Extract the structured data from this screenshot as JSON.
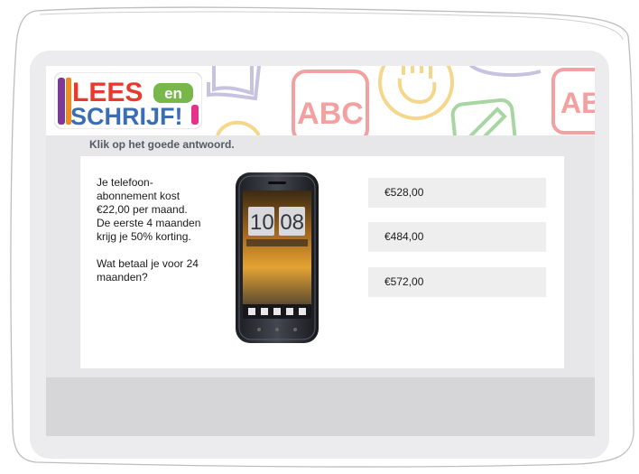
{
  "logo": {
    "line1": "LEES",
    "line1_small": "en",
    "line2": "SCHRIJF!",
    "colors": {
      "red": "#e63a2e",
      "purple": "#7b3a95",
      "orange": "#f28c1e",
      "green": "#78b84a",
      "blue": "#3a6db5",
      "pink": "#e8318a"
    }
  },
  "banner": {
    "deco_text_abc": "ABC",
    "deco_text_ab": "AB",
    "colors": {
      "red": "#f3a0a0",
      "yellow": "#f5d68a",
      "purple": "#c7c2e0",
      "green": "#a7d6a2"
    }
  },
  "instruction": "Klik op het goede antwoord.",
  "question": {
    "lines": [
      "Je telefoon-",
      "abonnement kost",
      "€22,00 per maand.",
      "De eerste 4 maanden",
      "krijg je 50% korting."
    ],
    "prompt_lines": [
      "Wat betaal je voor 24",
      "maanden?"
    ]
  },
  "phone": {
    "time": "10 08",
    "icons": [
      "phone-icon",
      "home-icon",
      "apps-icon",
      "messages-icon",
      "camera-icon"
    ]
  },
  "answers": [
    "€528,00",
    "€484,00",
    "€572,00"
  ],
  "colors": {
    "tablet": "#ececee",
    "screen": "#e7e7e9",
    "answer_bg": "#eeeeef",
    "footer": "#d6d6d8"
  }
}
